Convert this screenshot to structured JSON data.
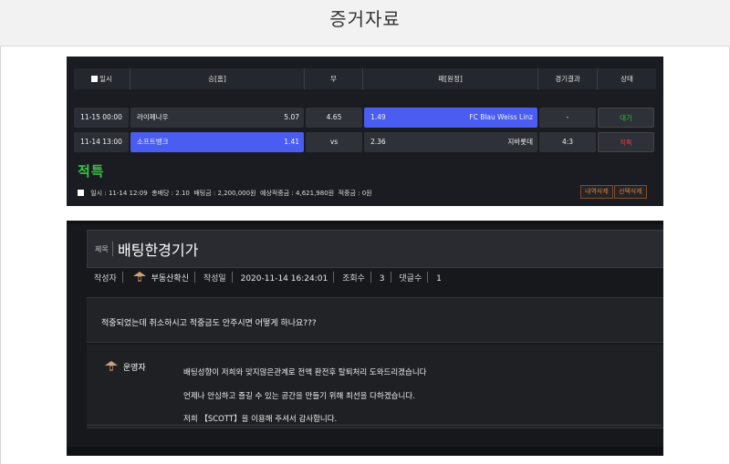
{
  "page": {
    "title": "증거자료"
  },
  "bet_slip": {
    "headers": {
      "datetime": "일시",
      "home": "승[홈]",
      "draw": "무",
      "away": "패[원정]",
      "result": "경기결과",
      "status": "상태"
    },
    "rows": [
      {
        "datetime": "11-15 00:00",
        "home_team": "라이페나우",
        "home_odds": "5.07",
        "draw": "4.65",
        "away_odds": "1.49",
        "away_team": "FC Blau Weiss Linz",
        "result": "-",
        "status": "대기",
        "selected": "away"
      },
      {
        "datetime": "11-14 13:00",
        "home_team": "소프트뱅크",
        "home_odds": "1.41",
        "draw": "vs",
        "away_odds": "2.36",
        "away_team": "지바롯데",
        "result": "4:3",
        "status": "적특",
        "selected": "home"
      }
    ],
    "hit_label": "적특",
    "summary": {
      "datetime_label": "일시 :",
      "datetime": "11-14 12:09",
      "odds_label": "총배당 :",
      "odds": "2.10",
      "bet_label": "배팅금 :",
      "bet": "2,200,000원",
      "expected_label": "예상적중금 :",
      "expected": "4,621,980원",
      "won_label": "적중금 :",
      "won": "0원"
    },
    "buttons": {
      "history_delete": "내역삭제",
      "select_delete": "선택삭제"
    },
    "colors": {
      "selected": "#4a5df0",
      "win": "#2fbf3a",
      "lose": "#e33b3b",
      "hit": "#39c247"
    }
  },
  "post": {
    "title_label": "제목",
    "title": "배팅한경기가",
    "author_label": "작성자",
    "author": "부동산확신",
    "date_label": "작성일",
    "date": "2020-11-14 16:24:01",
    "views_label": "조회수",
    "views": "3",
    "comments_label": "댓글수",
    "comments": "1",
    "body": "적중되었는데 취소하시고 적중금도 안주시면 어떻게 하나요???",
    "reply": {
      "author": "운영자",
      "lines": [
        "배팅성향이 저희와 맞지않은관계로 전액 환전후 탈퇴처리 도와드리겠습니다",
        "언제나 안심하고 즐길 수 있는 공간을 만들기 위해 최선을 다하겠습니다.",
        "저희 【SCOTT】을 이용해 주셔서 감사합니다."
      ]
    },
    "icons": {
      "author": "hat-icon",
      "reply_author": "hat-icon"
    }
  }
}
